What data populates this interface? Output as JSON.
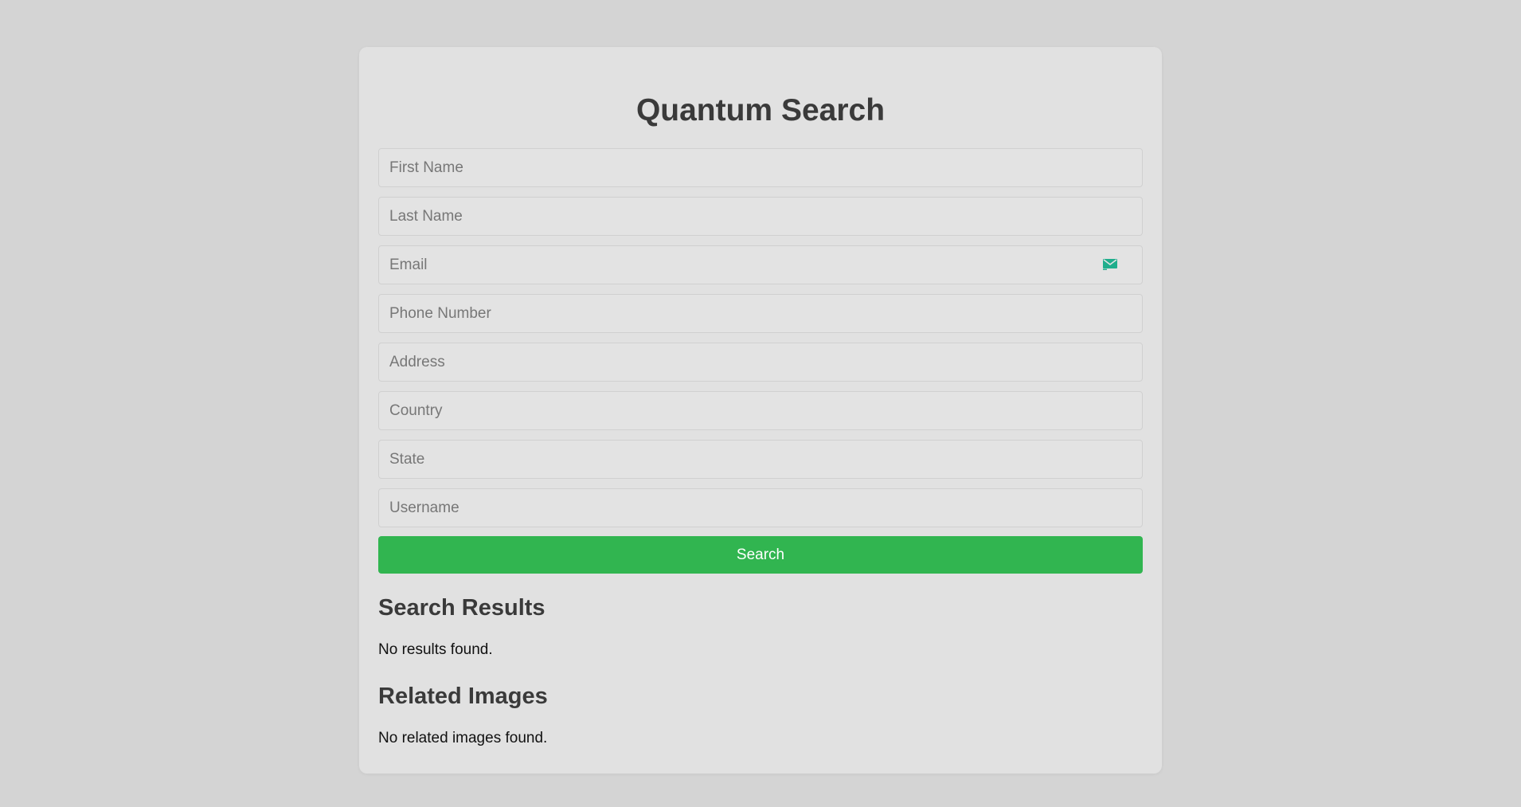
{
  "app": {
    "title": "Quantum Search"
  },
  "form": {
    "fields": [
      {
        "name": "first-name",
        "placeholder": "First Name",
        "value": ""
      },
      {
        "name": "last-name",
        "placeholder": "Last Name",
        "value": ""
      },
      {
        "name": "email",
        "placeholder": "Email",
        "value": "",
        "icon": "mail-icon"
      },
      {
        "name": "phone-number",
        "placeholder": "Phone Number",
        "value": ""
      },
      {
        "name": "address",
        "placeholder": "Address",
        "value": ""
      },
      {
        "name": "country",
        "placeholder": "Country",
        "value": ""
      },
      {
        "name": "state",
        "placeholder": "State",
        "value": ""
      },
      {
        "name": "username",
        "placeholder": "Username",
        "value": ""
      }
    ],
    "search_label": "Search"
  },
  "results": {
    "heading": "Search Results",
    "empty_text": "No results found."
  },
  "images": {
    "heading": "Related Images",
    "empty_text": "No related images found."
  },
  "colors": {
    "background": "#d4d4d4",
    "card": "#e1e1e1",
    "accent": "#31b550",
    "icon": "#1fae8c"
  }
}
